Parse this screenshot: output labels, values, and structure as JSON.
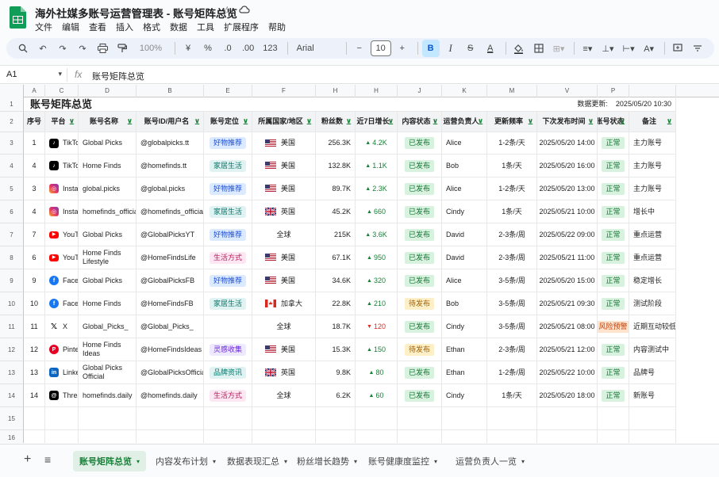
{
  "app": {
    "title": "海外社媒多账号运营管理表 - 账号矩阵总览",
    "menu": [
      "文件",
      "编辑",
      "查看",
      "插入",
      "格式",
      "数据",
      "工具",
      "扩展程序",
      "帮助"
    ]
  },
  "toolbar": {
    "zoom": "100%",
    "currency": "¥",
    "percent": "%",
    "decrease_decimal": ".0",
    "increase_decimal": ".00",
    "number_format": "123",
    "font": "Arial",
    "font_size": "10",
    "bold": "B",
    "italic": "I",
    "strike": "S",
    "text_color": "A"
  },
  "formula_bar": {
    "cell_ref": "A1",
    "fx": "fx",
    "content": "账号矩阵总览"
  },
  "columns": [
    "A",
    "C",
    "D",
    "B",
    "E",
    "F",
    "H",
    "H",
    "J",
    "K",
    "M",
    "V",
    "P"
  ],
  "sheet": {
    "title": "账号矩阵总览",
    "updated_label": "数据更新:",
    "updated_value": "2025/05/20 10:30",
    "headers": [
      "序号",
      "平台",
      "账号名称",
      "账号ID/用户名",
      "账号定位",
      "所属国家/地区",
      "粉丝数",
      "近7日增长",
      "内容状态",
      "运营负责人",
      "更新频率",
      "下次发布时间",
      "账号状态",
      "备注"
    ],
    "rows": [
      {
        "num": "1",
        "platform": "TikTok",
        "picon": "tiktok-icon",
        "name": "Global Picks",
        "handle": "@globalpicks.tt",
        "position": "好物推荐",
        "pos_style": "blue",
        "flag": "us",
        "country": "美国",
        "fans": "256.3K",
        "growth": "4.2K",
        "trend": "up",
        "content": "已发布",
        "owner": "Alice",
        "freq": "1-2条/天",
        "next": "2025/05/20 14:00",
        "status": "正常",
        "note": "主力账号"
      },
      {
        "num": "4",
        "platform": "TikTok",
        "picon": "tiktok-icon",
        "name": "Home Finds",
        "handle": "@homefinds.tt",
        "position": "家居生活",
        "pos_style": "teal",
        "flag": "us",
        "country": "美国",
        "fans": "132.8K",
        "growth": "1.1K",
        "trend": "up",
        "content": "已发布",
        "owner": "Bob",
        "freq": "1条/天",
        "next": "2025/05/20 16:00",
        "status": "正常",
        "note": "主力账号"
      },
      {
        "num": "3",
        "platform": "Instagram",
        "picon": "instagram-icon",
        "name": "global.picks",
        "handle": "@global.picks",
        "position": "好物推荐",
        "pos_style": "blue",
        "flag": "us",
        "country": "美国",
        "fans": "89.7K",
        "growth": "2.3K",
        "trend": "up",
        "content": "已发布",
        "owner": "Alice",
        "freq": "1-2条/天",
        "next": "2025/05/20 13:00",
        "status": "正常",
        "note": "主力账号"
      },
      {
        "num": "4",
        "platform": "Instagram",
        "picon": "instagram-icon",
        "name": "homefinds_official",
        "handle": "@homefinds_official",
        "position": "家居生活",
        "pos_style": "teal",
        "flag": "uk",
        "country": "英国",
        "fans": "45.2K",
        "growth": "660",
        "trend": "up",
        "content": "已发布",
        "owner": "Cindy",
        "freq": "1条/天",
        "next": "2025/05/21 10:00",
        "status": "正常",
        "note": "增长中"
      },
      {
        "num": "7",
        "platform": "YouTube",
        "picon": "youtube-icon",
        "name": "Global Picks",
        "handle": "@GlobalPicksYT",
        "position": "好物推荐",
        "pos_style": "blue",
        "flag": "",
        "country": "全球",
        "fans": "215K",
        "growth": "3.6K",
        "trend": "up",
        "content": "已发布",
        "owner": "David",
        "freq": "2-3条/周",
        "next": "2025/05/22 09:00",
        "status": "正常",
        "note": "重点运营"
      },
      {
        "num": "6",
        "platform": "YouTube",
        "picon": "youtube-icon",
        "name": "Home Finds Lifestyle",
        "handle": "@HomeFindsLife",
        "position": "生活方式",
        "pos_style": "pink",
        "flag": "us",
        "country": "美国",
        "fans": "67.1K",
        "growth": "950",
        "trend": "up",
        "content": "已发布",
        "owner": "David",
        "freq": "2-3条/周",
        "next": "2025/05/21 11:00",
        "status": "正常",
        "note": "重点运营"
      },
      {
        "num": "9",
        "platform": "Facebook",
        "picon": "facebook-icon",
        "name": "Global Picks",
        "handle": "@GlobalPicksFB",
        "position": "好物推荐",
        "pos_style": "blue",
        "flag": "us",
        "country": "美国",
        "fans": "34.6K",
        "growth": "320",
        "trend": "up",
        "content": "已发布",
        "owner": "Alice",
        "freq": "3-5条/周",
        "next": "2025/05/20 15:00",
        "status": "正常",
        "note": "稳定增长"
      },
      {
        "num": "10",
        "platform": "Facebook",
        "picon": "facebook-icon",
        "name": "Home Finds",
        "handle": "@HomeFindsFB",
        "position": "家居生活",
        "pos_style": "teal",
        "flag": "ca",
        "country": "加拿大",
        "fans": "22.8K",
        "growth": "210",
        "trend": "up",
        "content": "待发布",
        "owner": "Bob",
        "freq": "3-5条/周",
        "next": "2025/05/21 09:30",
        "status": "正常",
        "note": "测试阶段"
      },
      {
        "num": "11",
        "platform": "X",
        "picon": "x-icon",
        "name": "Global_Picks_",
        "handle": "@Global_Picks_",
        "position": "",
        "pos_style": "",
        "flag": "",
        "country": "全球",
        "fans": "18.7K",
        "growth": "120",
        "trend": "down",
        "content": "已发布",
        "owner": "Cindy",
        "freq": "3-5条/周",
        "next": "2025/05/21 08:00",
        "status": "风险预警",
        "note": "近期互动较低"
      },
      {
        "num": "12",
        "platform": "Pinterest",
        "picon": "pinterest-icon",
        "name": "Home Finds Ideas",
        "handle": "@HomeFindsIdeas",
        "position": "灵感收集",
        "pos_style": "purple",
        "flag": "us",
        "country": "美国",
        "fans": "15.3K",
        "growth": "150",
        "trend": "up",
        "content": "待发布",
        "owner": "Ethan",
        "freq": "2-3条/周",
        "next": "2025/05/21 12:00",
        "status": "正常",
        "note": "内容测试中"
      },
      {
        "num": "13",
        "platform": "LinkedIn",
        "picon": "linkedin-icon",
        "name": "Global Picks Official",
        "handle": "@GlobalPicksOfficial",
        "position": "品牌资讯",
        "pos_style": "teal",
        "flag": "uk",
        "country": "英国",
        "fans": "9.8K",
        "growth": "80",
        "trend": "up",
        "content": "已发布",
        "owner": "Ethan",
        "freq": "1-2条/周",
        "next": "2025/05/22 10:00",
        "status": "正常",
        "note": "品牌号"
      },
      {
        "num": "14",
        "platform": "Threads",
        "picon": "threads-icon",
        "name": "homefinds.daily",
        "handle": "@homefinds.daily",
        "position": "生活方式",
        "pos_style": "pink",
        "flag": "",
        "country": "全球",
        "fans": "6.2K",
        "growth": "60",
        "trend": "up",
        "content": "已发布",
        "owner": "Cindy",
        "freq": "1条/天",
        "next": "2025/05/20 18:00",
        "status": "正常",
        "note": "新账号"
      }
    ],
    "row_numbers": [
      "1",
      "2",
      "3",
      "4",
      "5",
      "6",
      "7",
      "8",
      "9",
      "10",
      "11",
      "12",
      "13",
      "14",
      "15",
      "16"
    ]
  },
  "tabs": [
    {
      "label": "账号矩阵总览",
      "active": true
    },
    {
      "label": "内容发布计划",
      "active": false
    },
    {
      "label": "数据表现汇总",
      "active": false
    },
    {
      "label": "粉丝增长趋势",
      "active": false
    },
    {
      "label": "账号健康度监控",
      "active": false
    },
    {
      "label": "运营负责人一览",
      "active": false
    }
  ],
  "colors": {
    "accent_green": "#188038",
    "selected_blue": "#c2e7ff",
    "header_bg": "#f1f3f4"
  }
}
